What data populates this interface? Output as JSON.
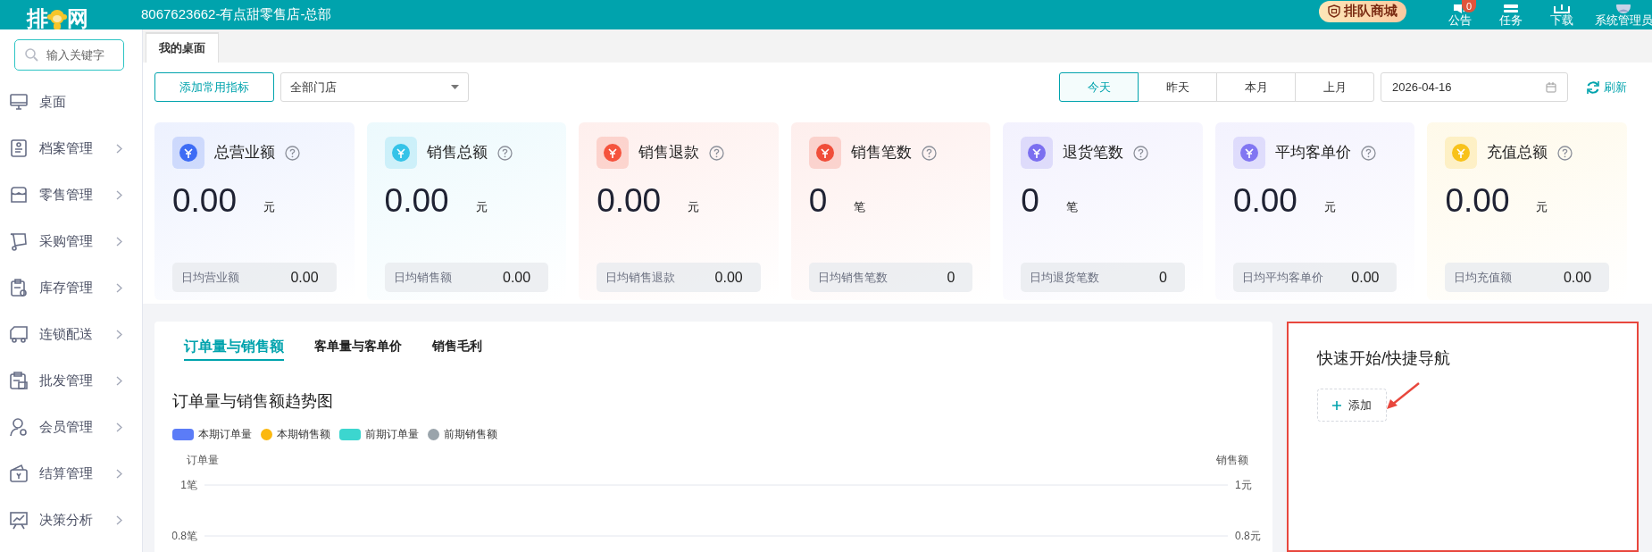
{
  "header": {
    "logo": {
      "left": "排",
      "right": "网"
    },
    "store_title": "8067623662-有点甜零售店-总部",
    "mall_button": "排队商城",
    "tools": [
      {
        "label": "公告",
        "badge": "0"
      },
      {
        "label": "任务"
      },
      {
        "label": "下载"
      },
      {
        "label": "系统管理员"
      }
    ]
  },
  "sidebar": {
    "search": {
      "placeholder": "输入关键字"
    },
    "items": [
      {
        "label": "桌面",
        "expandable": false
      },
      {
        "label": "档案管理",
        "expandable": true
      },
      {
        "label": "零售管理",
        "expandable": true
      },
      {
        "label": "采购管理",
        "expandable": true
      },
      {
        "label": "库存管理",
        "expandable": true
      },
      {
        "label": "连锁配送",
        "expandable": true
      },
      {
        "label": "批发管理",
        "expandable": true
      },
      {
        "label": "会员管理",
        "expandable": true
      },
      {
        "label": "结算管理",
        "expandable": true
      },
      {
        "label": "决策分析",
        "expandable": true
      }
    ]
  },
  "tabs": [
    {
      "label": "我的桌面",
      "selected": true
    }
  ],
  "toolbar": {
    "add_button": "添加常用指标",
    "store_select": "全部门店",
    "periods": [
      {
        "label": "今天",
        "selected": true
      },
      {
        "label": "昨天",
        "selected": false
      },
      {
        "label": "本月",
        "selected": false
      },
      {
        "label": "上月",
        "selected": false
      }
    ],
    "date": "2026-04-16",
    "refresh": "刷新"
  },
  "cards": [
    {
      "title": "总营业额",
      "value": "0.00",
      "unit": "元",
      "avg_label": "日均营业额",
      "avg_value": "0.00",
      "color": "#3d6cf5"
    },
    {
      "title": "销售总额",
      "value": "0.00",
      "unit": "元",
      "avg_label": "日均销售额",
      "avg_value": "0.00",
      "color": "#35c3e8"
    },
    {
      "title": "销售退款",
      "value": "0.00",
      "unit": "元",
      "avg_label": "日均销售退款",
      "avg_value": "0.00",
      "color": "#f5533d"
    },
    {
      "title": "销售笔数",
      "value": "0",
      "unit": "笔",
      "avg_label": "日均销售笔数",
      "avg_value": "0",
      "color": "#f04e3a"
    },
    {
      "title": "退货笔数",
      "value": "0",
      "unit": "笔",
      "avg_label": "日均退货笔数",
      "avg_value": "0",
      "color": "#7b6ff0"
    },
    {
      "title": "平均客单价",
      "value": "0.00",
      "unit": "元",
      "avg_label": "日均平均客单价",
      "avg_value": "0.00",
      "color": "#8176f2"
    },
    {
      "title": "充值总额",
      "value": "0.00",
      "unit": "元",
      "avg_label": "日均充值额",
      "avg_value": "0.00",
      "color": "#f8c21a"
    }
  ],
  "chart_panel": {
    "tabs": [
      {
        "label": "订单量与销售额",
        "selected": true
      },
      {
        "label": "客单量与客单价",
        "selected": false
      },
      {
        "label": "销售毛利",
        "selected": false
      }
    ],
    "chart_data": {
      "type": "line",
      "title": "订单量与销售额趋势图",
      "ylabel": "订单量",
      "y2label": "销售额",
      "ylim": [
        0.8,
        1
      ],
      "y2lim": [
        0.8,
        1
      ],
      "yticks": [
        {
          "value": 1,
          "label": "1笔"
        },
        {
          "value": 0.8,
          "label": "0.8笔"
        }
      ],
      "y2ticks": [
        {
          "value": 1,
          "label": "1元"
        },
        {
          "value": 0.8,
          "label": "0.8元"
        }
      ],
      "series": [
        {
          "name": "本期订单量",
          "color": "#5b7cf7"
        },
        {
          "name": "本期销售额",
          "color": "#fbb80f"
        },
        {
          "name": "前期订单量",
          "color": "#3cd6cf"
        },
        {
          "name": "前期销售额",
          "color": "#9aa4ab"
        }
      ]
    }
  },
  "quick_nav": {
    "title": "快速开始/快捷导航",
    "add_button": "添加"
  }
}
